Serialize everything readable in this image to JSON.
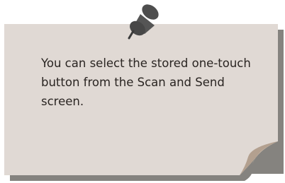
{
  "note": {
    "text": "You can select the stored one-touch\nbutton from the Scan and Send\nscreen."
  },
  "colors": {
    "paper": "#e0d9d4",
    "shadow": "#85837f",
    "curl": "#b3a08f",
    "pin": "#4a4a4a",
    "text": "#2a2522"
  },
  "icons": {
    "pin": "pushpin-icon",
    "curl": "page-curl"
  }
}
